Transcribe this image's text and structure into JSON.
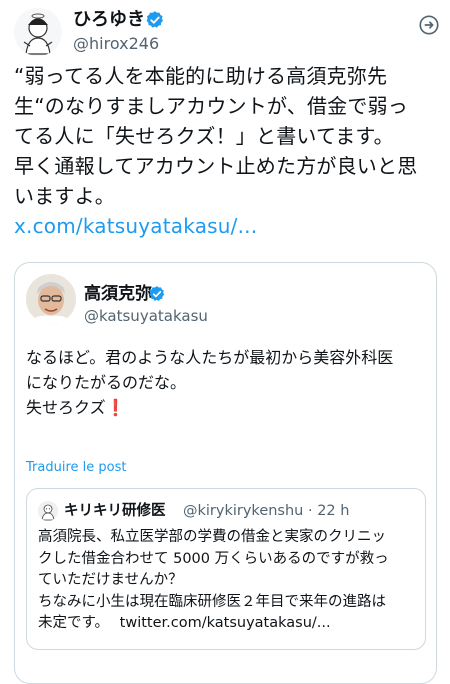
{
  "main_tweet": {
    "author_name": "ひろゆき",
    "author_handle": "@hirox246",
    "text_lines": [
      "“弱ってる人を本能的に助ける高須克弥先",
      "生“のなりすましアカウントが、借金で弱っ",
      "てる人に「失せろクズ！」と書いてます。",
      "早く通報してアカウント止めた方が良いと思",
      "いますよ。"
    ],
    "link": "x.com/katsuyatakasu/...",
    "more_icon": "more-icon"
  },
  "quote_tweet": {
    "author_name": "高須克弥",
    "author_handle": "@katsuyatakasu",
    "text_lines": [
      "なるほど。君のような人たちが最初から美容外科医",
      "になりたがるのだな。",
      "失せろクズ"
    ],
    "emoji": "❗",
    "translate_label": "Traduire le post"
  },
  "inner_quote": {
    "author_name": "キリキリ研修医",
    "author_handle": "@kirykirykenshu",
    "time": "· 22 h",
    "text_lines": [
      "高須院長、私立医学部の学費の借金と実家のクリニッ",
      "クした借金合わせて 5000 万くらいあるのですが救っ",
      "ていただけませんか？",
      "ちなみに小生は現在臨床研修医２年目で来年の進路は",
      "未定です。"
    ],
    "link": "twitter.com/katsuyatakasu/..."
  },
  "colors": {
    "accent": "#1d9bf0",
    "text": "#0f1419",
    "secondary": "#536471",
    "border": "#cfd9de"
  }
}
